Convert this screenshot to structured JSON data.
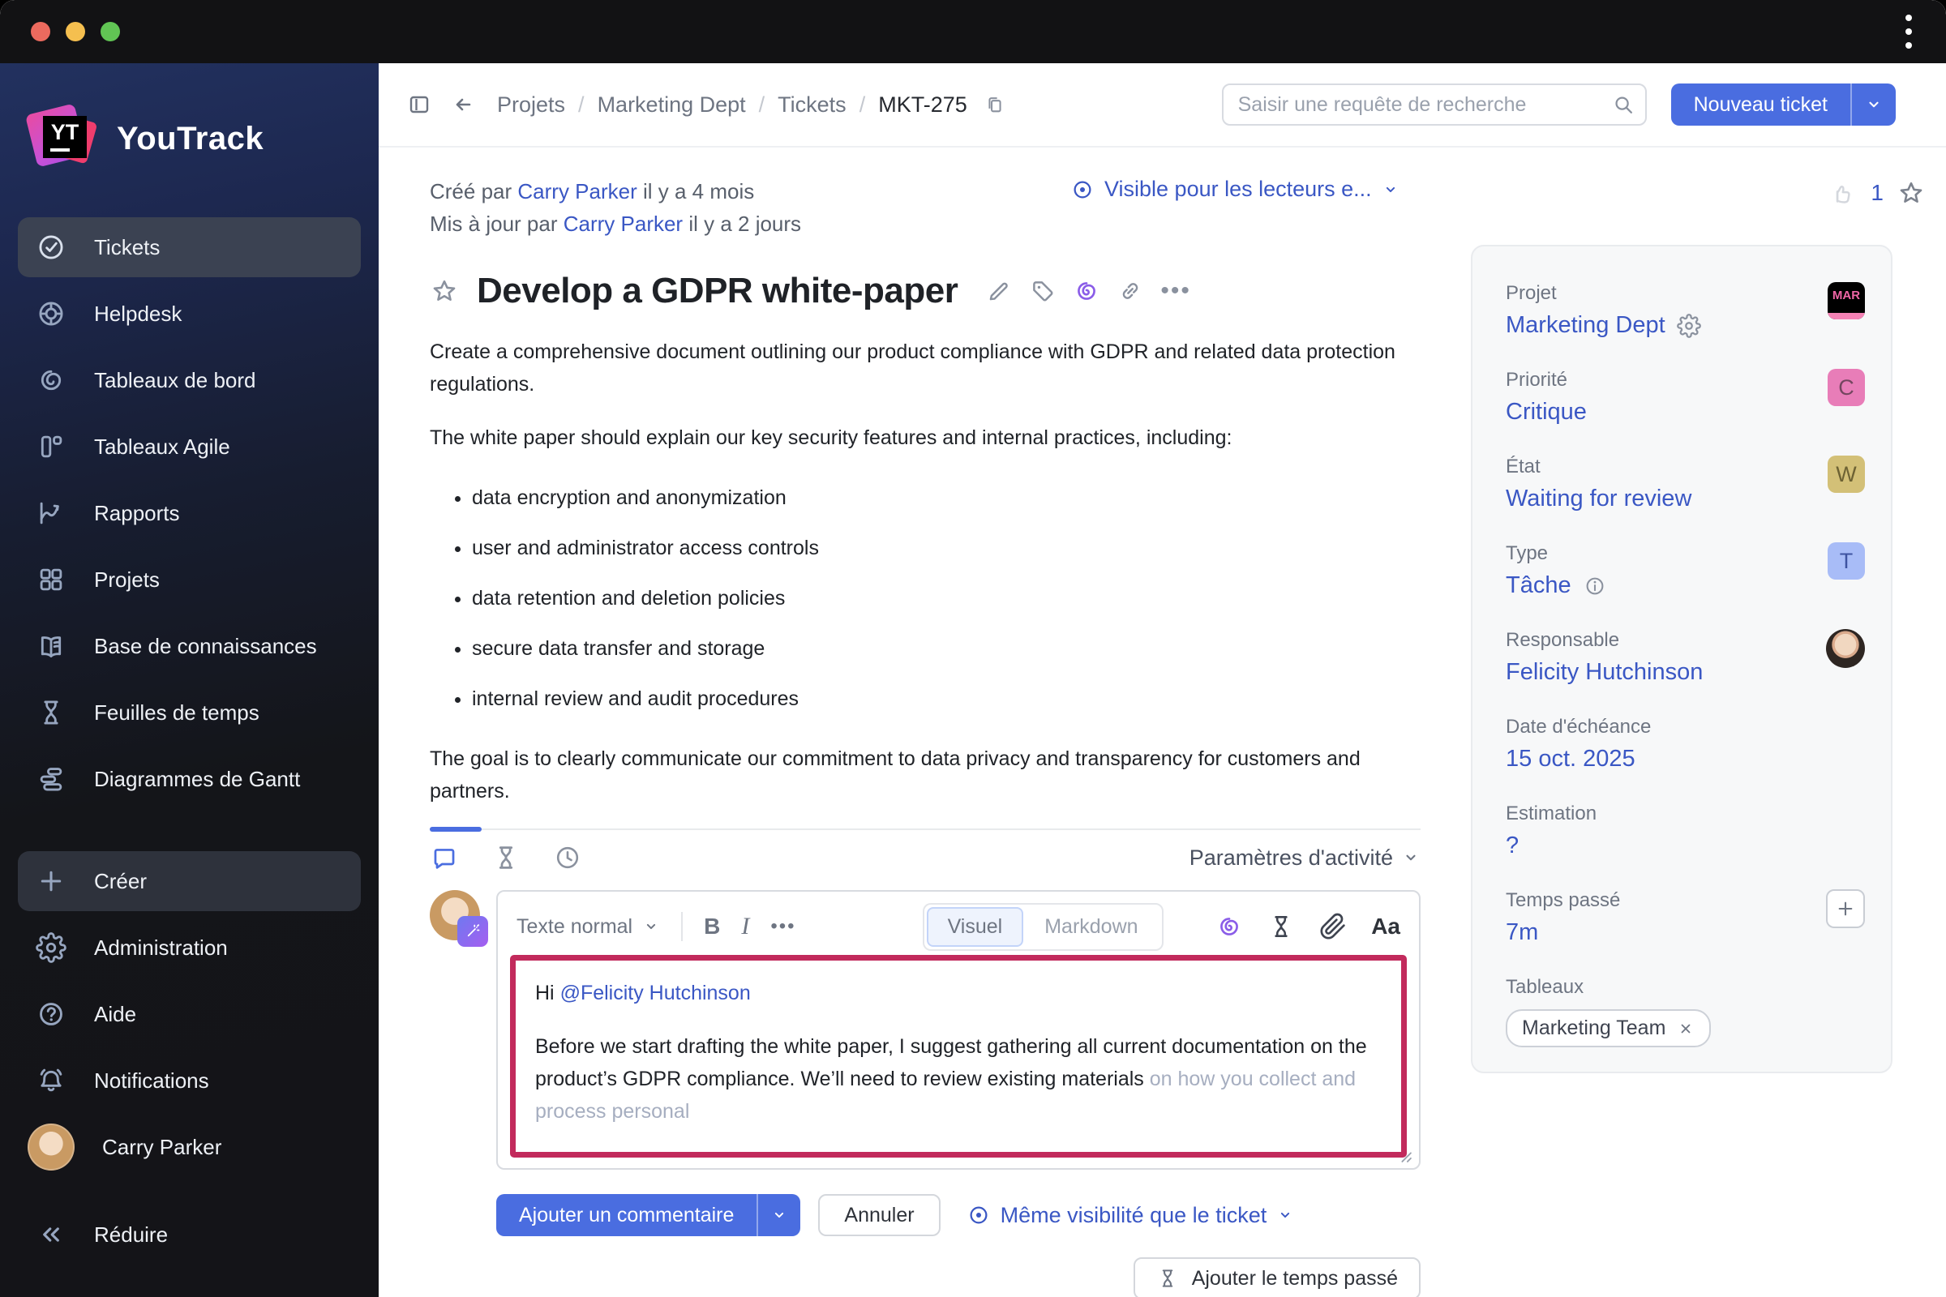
{
  "window": {
    "menu_icon": "kebab-vertical-icon"
  },
  "sidebar": {
    "logo_text": "YouTrack",
    "logo_badge": "YT",
    "items": [
      {
        "label": "Tickets",
        "icon": "check-circle-icon",
        "active": true
      },
      {
        "label": "Helpdesk",
        "icon": "lifebuoy-icon"
      },
      {
        "label": "Tableaux de bord",
        "icon": "gauge-icon"
      },
      {
        "label": "Tableaux Agile",
        "icon": "agile-board-icon"
      },
      {
        "label": "Rapports",
        "icon": "chart-icon"
      },
      {
        "label": "Projets",
        "icon": "grid-icon"
      },
      {
        "label": "Base de connaissances",
        "icon": "book-icon"
      },
      {
        "label": "Feuilles de temps",
        "icon": "hourglass-icon"
      },
      {
        "label": "Diagrammes de Gantt",
        "icon": "gantt-icon"
      }
    ],
    "create_label": "Créer",
    "admin_label": "Administration",
    "help_label": "Aide",
    "notifications_label": "Notifications",
    "profile_name": "Carry Parker",
    "collapse_label": "Réduire"
  },
  "header": {
    "breadcrumb": {
      "items": [
        "Projets",
        "Marketing Dept",
        "Tickets"
      ],
      "current": "MKT-275",
      "sep": "/"
    },
    "search_placeholder": "Saisir une requête de recherche",
    "new_ticket_label": "Nouveau ticket"
  },
  "issue": {
    "created": {
      "prefix": "Créé par",
      "author": "Carry Parker",
      "suffix": "il y a 4 mois"
    },
    "updated": {
      "prefix": "Mis à jour par",
      "author": "Carry Parker",
      "suffix": "il y a 2 jours"
    },
    "visibility_label": "Visible pour les lecteurs e...",
    "likes_count": "1",
    "title": "Develop a GDPR white-paper",
    "description": {
      "p1": "Create a comprehensive document outlining our product compliance with GDPR and related data protection regulations.",
      "p2": "The white paper should explain our key security features and internal practices, including:",
      "bullets": [
        "data encryption and anonymization",
        "user and administrator access controls",
        "data retention and deletion policies",
        "secure data transfer and storage",
        "internal review and audit procedures"
      ],
      "p3": "The goal is to clearly communicate our commitment to data privacy and transparency for customers and partners."
    }
  },
  "activity": {
    "settings_label": "Paramètres d'activité"
  },
  "editor": {
    "style_select": "Texte normal",
    "bold_label": "B",
    "italic_label": "I",
    "more_label": "•••",
    "visual_tab": "Visuel",
    "markdown_tab": "Markdown",
    "format_label": "Aa",
    "comment_greeting": "Hi ",
    "comment_mention": "@Felicity Hutchinson",
    "comment_body": "Before we start drafting the white paper, I suggest gathering all current documentation on the product’s GDPR compliance. We’ll need to review existing materials",
    "comment_ghost": " on how you collect and process personal",
    "submit_label": "Ajouter un commentaire",
    "cancel_label": "Annuler",
    "visibility_label": "Même visibilité que le ticket",
    "add_time_label": "Ajouter le temps passé"
  },
  "panel": {
    "fields": [
      {
        "label": "Projet",
        "value": "Marketing Dept",
        "badge": "MAR"
      },
      {
        "label": "Priorité",
        "value": "Critique",
        "badge": "C"
      },
      {
        "label": "État",
        "value": "Waiting for review",
        "badge": "W"
      },
      {
        "label": "Type",
        "value": "Tâche",
        "badge": "T"
      },
      {
        "label": "Responsable",
        "value": "Felicity Hutchinson"
      },
      {
        "label": "Date d'échéance",
        "value": "15 oct. 2025"
      },
      {
        "label": "Estimation",
        "value": "?"
      },
      {
        "label": "Temps passé",
        "value": "7m"
      },
      {
        "label": "Tableaux",
        "chip": "Marketing Team"
      }
    ]
  },
  "colors": {
    "accent_blue": "#4a6de0",
    "link_blue": "#3a57c4",
    "highlight_pink": "#c22a5c",
    "badge_priority": "#e87db8",
    "badge_state": "#d3c077",
    "badge_type": "#a8bcf7",
    "badge_project_bg": "#000000",
    "badge_project_text": "#f066a6"
  },
  "icons": {
    "search": "magnifier",
    "back": "arrow-left",
    "sidebar_toggle": "panel-left",
    "issue_copy": "copy",
    "visibility": "circled-dot",
    "like": "thumbs-up",
    "favorite": "star",
    "edit": "pencil",
    "tags": "tag",
    "ai": "purple-swirl",
    "link": "chain",
    "comments_tab": "speech-bubble",
    "history_tab": "hourglass",
    "time_tab": "clock",
    "attach": "paperclip",
    "resize": "grip",
    "chip_close": "x",
    "add": "plus",
    "info": "info-circle",
    "project_settings": "gear",
    "avatar_badge": "magic-wand"
  }
}
